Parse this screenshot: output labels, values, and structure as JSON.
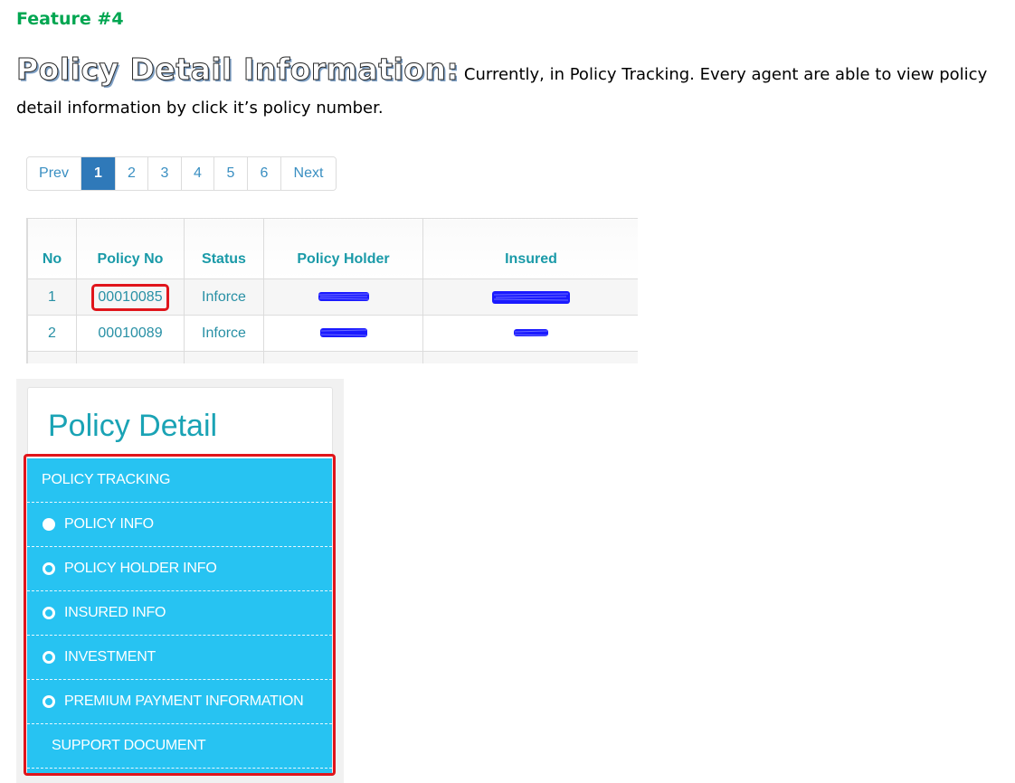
{
  "feature_label": "Feature #4",
  "heading": {
    "title": "Policy Detail Information:",
    "description": "Currently, in Policy Tracking. Every agent are able to view policy detail information by click it’s policy number."
  },
  "pagination": {
    "items": [
      "Prev",
      "1",
      "2",
      "3",
      "4",
      "5",
      "6",
      "Next"
    ],
    "active": "1"
  },
  "table": {
    "headers": [
      "No",
      "Policy No",
      "Status",
      "Policy Holder",
      "Insured"
    ],
    "rows": [
      {
        "no": "1",
        "policy_no": "00010085",
        "status": "Inforce"
      },
      {
        "no": "2",
        "policy_no": "00010089",
        "status": "Inforce"
      }
    ]
  },
  "policy_detail": {
    "title": "Policy Detail",
    "menu": [
      {
        "label": "POLICY TRACKING",
        "icon": "none"
      },
      {
        "label": "POLICY INFO",
        "icon": "filled-circle"
      },
      {
        "label": "POLICY HOLDER INFO",
        "icon": "empty-circle"
      },
      {
        "label": "INSURED INFO",
        "icon": "empty-circle"
      },
      {
        "label": "INVESTMENT",
        "icon": "empty-circle"
      },
      {
        "label": "PREMIUM PAYMENT INFORMATION",
        "icon": "empty-circle"
      },
      {
        "label": "SUPPORT DOCUMENT",
        "icon": "none"
      }
    ]
  },
  "colors": {
    "feature_green": "#00a651",
    "accent_teal": "#1aa3b5",
    "menu_blue": "#27c3f2",
    "highlight_red": "#e0151b",
    "pagination_active": "#2f79b9",
    "redaction_blue": "#1a1aff"
  }
}
